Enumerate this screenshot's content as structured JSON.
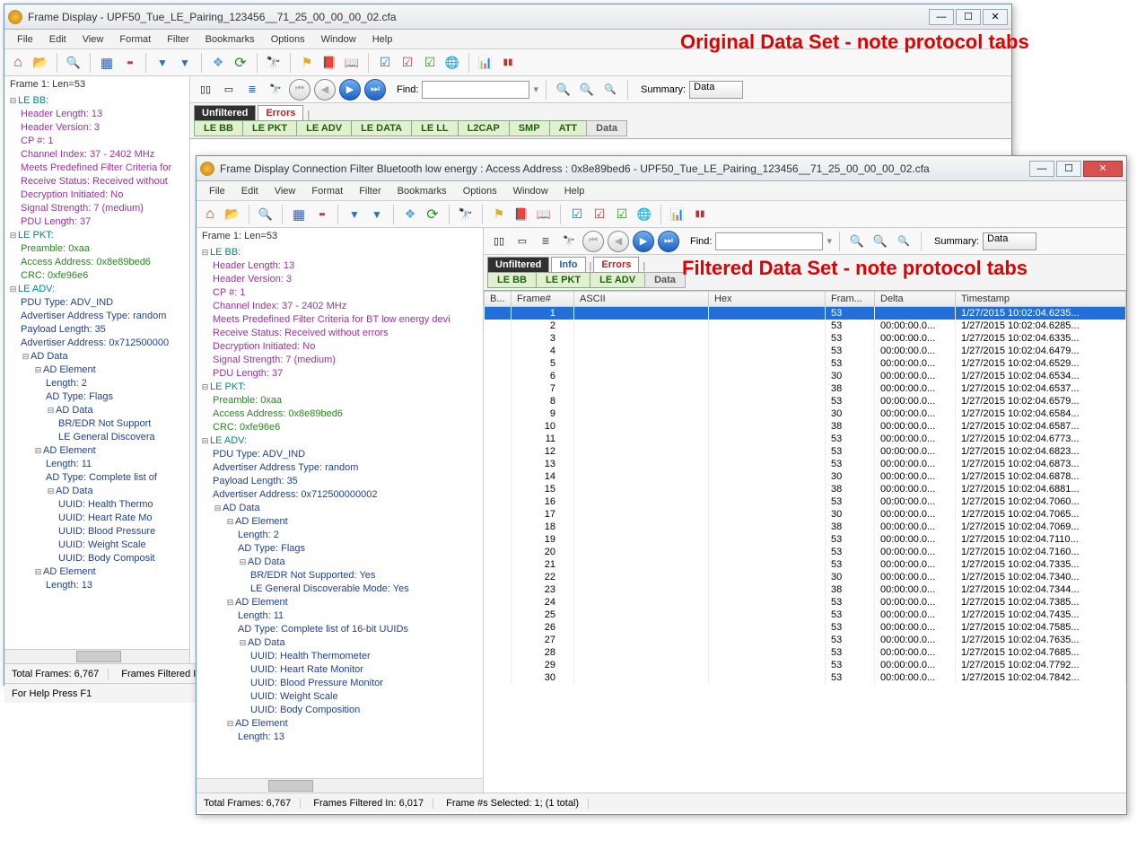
{
  "annot": {
    "original": "Original Data Set - note protocol tabs",
    "filtered": "Filtered Data Set - note protocol tabs"
  },
  "win1": {
    "title": "Frame Display - UPF50_Tue_LE_Pairing_123456__71_25_00_00_00_02.cfa",
    "frameHead": "Frame 1:  Len=53",
    "status": {
      "total": "Total Frames:  6,767",
      "filt": "Frames Filtered In:",
      "help": "For Help Press F1"
    },
    "tabs2": [
      "LE BB",
      "LE PKT",
      "LE ADV",
      "LE DATA",
      "LE LL",
      "L2CAP",
      "SMP",
      "ATT",
      "Data"
    ],
    "tabrow": {
      "unf": "Unfiltered",
      "err": "Errors"
    }
  },
  "win2": {
    "title": "Frame Display  Connection Filter Bluetooth low energy : Access Address : 0x8e89bed6 - UPF50_Tue_LE_Pairing_123456__71_25_00_00_00_02.cfa",
    "frameHead": "Frame 1:  Len=53",
    "status": {
      "total": "Total Frames:  6,767",
      "filt": "Frames Filtered In:  6,017",
      "sel": "Frame #s Selected:   1; (1 total)"
    },
    "tabs2": [
      "LE BB",
      "LE PKT",
      "LE ADV",
      "Data"
    ],
    "tabrow": {
      "unf": "Unfiltered",
      "info": "Info",
      "err": "Errors"
    },
    "cols": [
      "B...",
      "Frame#",
      "ASCII",
      "Hex",
      "Fram...",
      "Delta",
      "Timestamp"
    ],
    "rows": [
      {
        "n": "1",
        "f": "53",
        "d": "",
        "t": "1/27/2015 10:02:04.6235..."
      },
      {
        "n": "2",
        "f": "53",
        "d": "00:00:00.0...",
        "t": "1/27/2015 10:02:04.6285..."
      },
      {
        "n": "3",
        "f": "53",
        "d": "00:00:00.0...",
        "t": "1/27/2015 10:02:04.6335..."
      },
      {
        "n": "4",
        "f": "53",
        "d": "00:00:00.0...",
        "t": "1/27/2015 10:02:04.6479..."
      },
      {
        "n": "5",
        "f": "53",
        "d": "00:00:00.0...",
        "t": "1/27/2015 10:02:04.6529..."
      },
      {
        "n": "6",
        "f": "30",
        "d": "00:00:00.0...",
        "t": "1/27/2015 10:02:04.6534..."
      },
      {
        "n": "7",
        "f": "38",
        "d": "00:00:00.0...",
        "t": "1/27/2015 10:02:04.6537..."
      },
      {
        "n": "8",
        "f": "53",
        "d": "00:00:00.0...",
        "t": "1/27/2015 10:02:04.6579..."
      },
      {
        "n": "9",
        "f": "30",
        "d": "00:00:00.0...",
        "t": "1/27/2015 10:02:04.6584..."
      },
      {
        "n": "10",
        "f": "38",
        "d": "00:00:00.0...",
        "t": "1/27/2015 10:02:04.6587..."
      },
      {
        "n": "11",
        "f": "53",
        "d": "00:00:00.0...",
        "t": "1/27/2015 10:02:04.6773..."
      },
      {
        "n": "12",
        "f": "53",
        "d": "00:00:00.0...",
        "t": "1/27/2015 10:02:04.6823..."
      },
      {
        "n": "13",
        "f": "53",
        "d": "00:00:00.0...",
        "t": "1/27/2015 10:02:04.6873..."
      },
      {
        "n": "14",
        "f": "30",
        "d": "00:00:00.0...",
        "t": "1/27/2015 10:02:04.6878..."
      },
      {
        "n": "15",
        "f": "38",
        "d": "00:00:00.0...",
        "t": "1/27/2015 10:02:04.6881..."
      },
      {
        "n": "16",
        "f": "53",
        "d": "00:00:00.0...",
        "t": "1/27/2015 10:02:04.7060..."
      },
      {
        "n": "17",
        "f": "30",
        "d": "00:00:00.0...",
        "t": "1/27/2015 10:02:04.7065..."
      },
      {
        "n": "18",
        "f": "38",
        "d": "00:00:00.0...",
        "t": "1/27/2015 10:02:04.7069..."
      },
      {
        "n": "19",
        "f": "53",
        "d": "00:00:00.0...",
        "t": "1/27/2015 10:02:04.7110..."
      },
      {
        "n": "20",
        "f": "53",
        "d": "00:00:00.0...",
        "t": "1/27/2015 10:02:04.7160..."
      },
      {
        "n": "21",
        "f": "53",
        "d": "00:00:00.0...",
        "t": "1/27/2015 10:02:04.7335..."
      },
      {
        "n": "22",
        "f": "30",
        "d": "00:00:00.0...",
        "t": "1/27/2015 10:02:04.7340..."
      },
      {
        "n": "23",
        "f": "38",
        "d": "00:00:00.0...",
        "t": "1/27/2015 10:02:04.7344..."
      },
      {
        "n": "24",
        "f": "53",
        "d": "00:00:00.0...",
        "t": "1/27/2015 10:02:04.7385..."
      },
      {
        "n": "25",
        "f": "53",
        "d": "00:00:00.0...",
        "t": "1/27/2015 10:02:04.7435..."
      },
      {
        "n": "26",
        "f": "53",
        "d": "00:00:00.0...",
        "t": "1/27/2015 10:02:04.7585..."
      },
      {
        "n": "27",
        "f": "53",
        "d": "00:00:00.0...",
        "t": "1/27/2015 10:02:04.7635..."
      },
      {
        "n": "28",
        "f": "53",
        "d": "00:00:00.0...",
        "t": "1/27/2015 10:02:04.7685..."
      },
      {
        "n": "29",
        "f": "53",
        "d": "00:00:00.0...",
        "t": "1/27/2015 10:02:04.7792..."
      },
      {
        "n": "30",
        "f": "53",
        "d": "00:00:00.0...",
        "t": "1/27/2015 10:02:04.7842..."
      }
    ]
  },
  "menu": [
    "File",
    "Edit",
    "View",
    "Format",
    "Filter",
    "Bookmarks",
    "Options",
    "Window",
    "Help"
  ],
  "find": "Find:",
  "summary": "Summary:",
  "sumval": "Data",
  "tree1": {
    "lebb": "LE BB:",
    "lebb_items": [
      "Header Length: 13",
      "Header Version: 3",
      "CP #: 1",
      "Channel Index: 37 - 2402 MHz",
      "Meets Predefined Filter Criteria for",
      "Receive Status: Received without",
      "Decryption Initiated: No",
      "Signal Strength: 7 (medium)",
      "PDU Length: 37"
    ],
    "lepkt": "LE PKT:",
    "lepkt_items": [
      "Preamble: 0xaa",
      "Access Address: 0x8e89bed6",
      "CRC: 0xfe96e6"
    ],
    "leadv": "LE ADV:",
    "leadv_items": [
      "PDU Type: ADV_IND",
      "Advertiser Address Type: random",
      "Payload Length: 35",
      "Advertiser Address: 0x712500000"
    ],
    "addata": "AD Data",
    "adel": "AD Element",
    "len2": "Length: 2",
    "typeflags": "AD Type: Flags",
    "bredr": "BR/EDR Not Support",
    "legd": "LE General Discovera",
    "len11": "Length: 11",
    "typelist": "AD Type: Complete list of",
    "uuid1": "UUID: Health Thermo",
    "uuid2": "UUID: Heart Rate Mo",
    "uuid3": "UUID: Blood Pressure",
    "uuid4": "UUID: Weight Scale",
    "uuid5": "UUID: Body Composit",
    "len13": "Length: 13"
  },
  "tree2": {
    "lebb_items": [
      "Header Length: 13",
      "Header Version: 3",
      "CP #: 1",
      "Channel Index: 37 - 2402 MHz",
      "Meets Predefined Filter Criteria for BT low energy devi",
      "Receive Status: Received without errors",
      "Decryption Initiated: No",
      "Signal Strength: 7 (medium)",
      "PDU Length: 37"
    ],
    "leadv_items": [
      "PDU Type: ADV_IND",
      "Advertiser Address Type: random",
      "Payload Length: 35",
      "Advertiser Address: 0x712500000002"
    ],
    "bredr": "BR/EDR Not Supported: Yes",
    "legd": "LE General Discoverable Mode: Yes",
    "typelist": "AD Type: Complete list of 16-bit UUIDs",
    "uuid1": "UUID: Health Thermometer",
    "uuid2": "UUID: Heart Rate Monitor",
    "uuid3": "UUID: Blood Pressure Monitor",
    "uuid4": "UUID: Weight Scale",
    "uuid5": "UUID: Body Composition"
  }
}
